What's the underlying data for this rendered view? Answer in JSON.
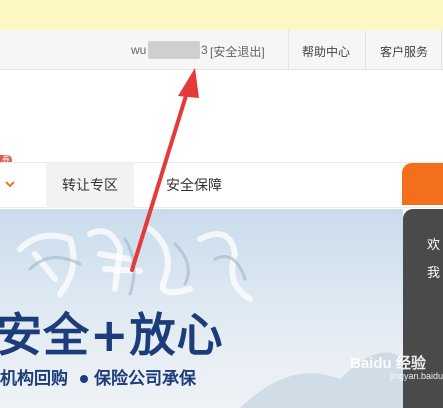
{
  "topbar": {
    "username_prefix": "wu",
    "username_suffix": "3",
    "logout_label": "[安全退出]",
    "help_label": "帮助中心",
    "service_label": "客户服务"
  },
  "nav": {
    "badge": "券",
    "items": [
      {
        "label": "转让专区"
      },
      {
        "label": "安全保障"
      }
    ]
  },
  "hero": {
    "calligraphy": "固若金汤",
    "title": "安全+放心",
    "sub_1": "机构回购",
    "sub_2": "保险公司承保"
  },
  "side_panel": {
    "line_1": "欢",
    "line_2": "我"
  },
  "watermark": {
    "brand": "Baidu 经验",
    "url": "jingyan.baidu.com"
  },
  "colors": {
    "accent_orange": "#f36f1c",
    "arrow_red": "#e43a3a",
    "hero_text": "#1d3c7a"
  }
}
